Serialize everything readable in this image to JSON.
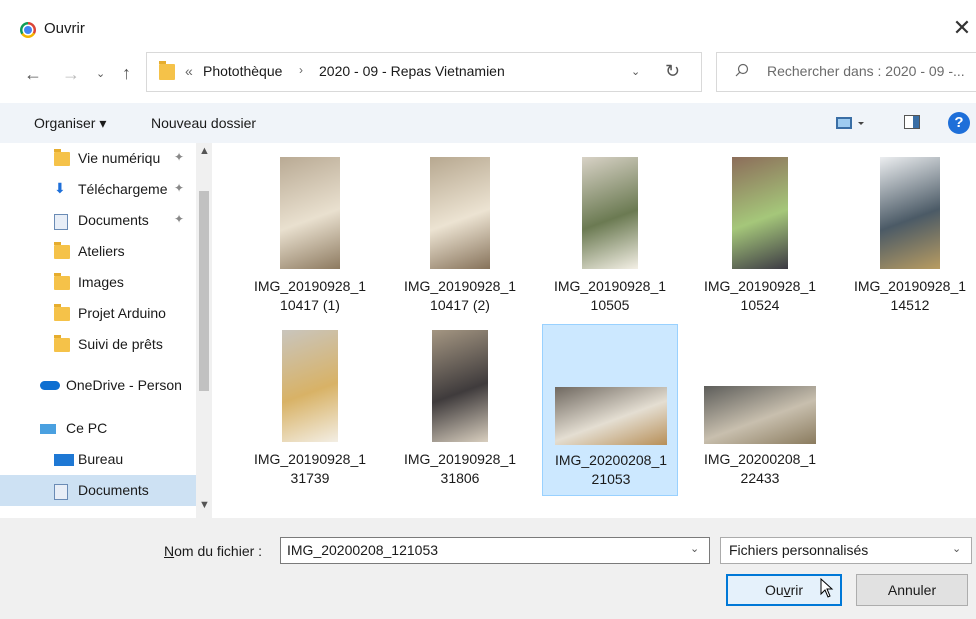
{
  "window": {
    "title": "Ouvrir",
    "close_glyph": "✕"
  },
  "nav": {
    "back_glyph": "←",
    "forward_glyph": "→",
    "recent_glyph": "⌄",
    "up_glyph": "↑",
    "breadcrumb_prefix": "«",
    "breadcrumbs": [
      "Photothèque",
      "2020 - 09 - Repas Vietnamien"
    ],
    "breadcrumb_sep": "›",
    "dropdown_glyph": "⌄",
    "refresh_glyph": "↻"
  },
  "search": {
    "placeholder": "Rechercher dans : 2020 - 09 -..."
  },
  "toolbar": {
    "organize_label": "Organiser ▾",
    "new_folder_label": "Nouveau dossier",
    "help_label": "?"
  },
  "sidebar": {
    "items": [
      {
        "label": "Vie numériqu",
        "icon": "folder-icon",
        "pinned": true
      },
      {
        "label": "Téléchargeme",
        "icon": "download-icon",
        "pinned": true
      },
      {
        "label": "Documents",
        "icon": "documents-icon",
        "pinned": true
      },
      {
        "label": "Ateliers",
        "icon": "folder-icon",
        "pinned": false
      },
      {
        "label": "Images",
        "icon": "folder-icon",
        "pinned": false
      },
      {
        "label": "Projet Arduino",
        "icon": "folder-icon",
        "pinned": false
      },
      {
        "label": "Suivi de prêts",
        "icon": "folder-icon",
        "pinned": false
      },
      {
        "label": "OneDrive - Person",
        "icon": "onedrive-icon",
        "pinned": false
      },
      {
        "label": "Ce PC",
        "icon": "pc-icon",
        "pinned": false
      },
      {
        "label": "Bureau",
        "icon": "desktop-icon",
        "pinned": false
      },
      {
        "label": "Documents",
        "icon": "documents-icon",
        "pinned": false,
        "selected": true
      }
    ],
    "pin_glyph": "📌"
  },
  "files": [
    {
      "name": "IMG_20190928_1\n10417 (1)"
    },
    {
      "name": "IMG_20190928_1\n10417 (2)"
    },
    {
      "name": "IMG_20190928_1\n10505"
    },
    {
      "name": "IMG_20190928_1\n10524"
    },
    {
      "name": "IMG_20190928_1\n14512"
    },
    {
      "name": "IMG_20190928_1\n31739"
    },
    {
      "name": "IMG_20190928_1\n31806"
    },
    {
      "name": "IMG_20200208_1\n21053",
      "selected": true
    },
    {
      "name": "IMG_20200208_1\n22433"
    }
  ],
  "footer": {
    "filename_label_prefix": "N",
    "filename_label_rest": "om du fichier :",
    "filename_value": "IMG_20200208_121053",
    "filetype_value": "Fichiers personnalisés",
    "open_label_a": "Ou",
    "open_label_u": "v",
    "open_label_b": "rir",
    "cancel_label": "Annuler"
  },
  "colors": {
    "accent": "#0078d7",
    "selection": "#cce8ff",
    "help": "#1e6fd9",
    "folder": "#f5c249"
  }
}
